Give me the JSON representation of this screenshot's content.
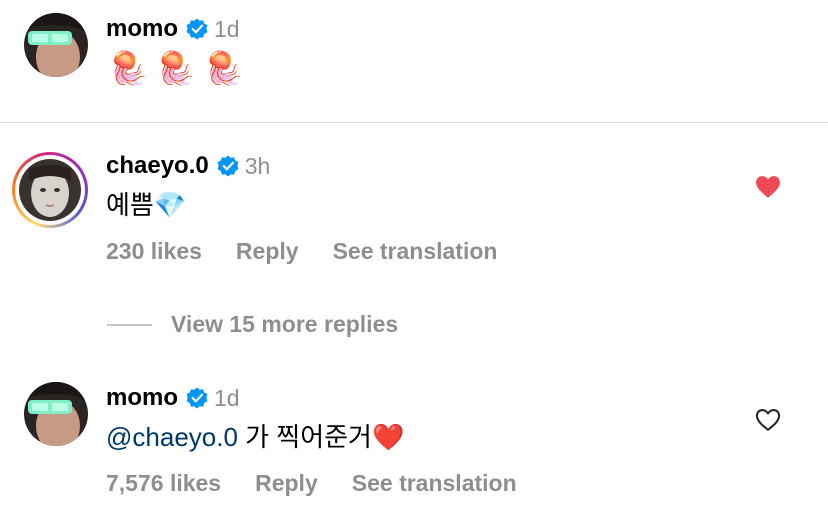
{
  "comment1": {
    "username": "momo",
    "time": "1d",
    "emojis": "🪼🪼🪼"
  },
  "comment2": {
    "username": "chaeyo.0",
    "time": "3h",
    "text": "예쁨💎",
    "likes": "230 likes",
    "reply": "Reply",
    "translate": "See translation",
    "liked": true
  },
  "thread": {
    "view_more": "View 15 more replies"
  },
  "comment3": {
    "username": "momo",
    "time": "1d",
    "mention": "@chaeyo.0",
    "text": " 가 찍어준거❤️",
    "likes": "7,576 likes",
    "reply": "Reply",
    "translate": "See translation",
    "liked": false
  },
  "colors": {
    "verified": "#0095f6",
    "like_red": "#ed4956",
    "meta_gray": "#8e8e8e",
    "mention": "#00376b"
  }
}
